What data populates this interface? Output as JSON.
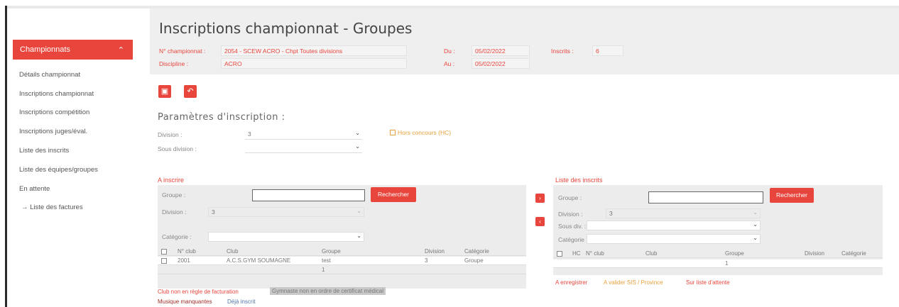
{
  "page": {
    "title": "Inscriptions championnat - Groupes"
  },
  "sidebar": {
    "header": "Championnats",
    "items": [
      "Détails championnat",
      "Inscriptions championnat",
      "Inscriptions compétition",
      "Inscriptions juges/éval.",
      "Liste des inscrits",
      "Liste des équipes/groupes",
      "En attente",
      "→ Liste des factures"
    ]
  },
  "header": {
    "num_label": "N° championnat :",
    "num_value": "2054 - SCEW ACRO - Chpt Toutes divisions",
    "discipline_label": "Discipline :",
    "discipline_value": "ACRO",
    "du_label": "Du :",
    "du_value": "05/02/2022",
    "au_label": "Au :",
    "au_value": "05/02/2022",
    "inscrits_label": "Inscrits :",
    "inscrits_value": "6"
  },
  "toolbar": {
    "save_icon": "save-icon",
    "back_icon": "back-icon"
  },
  "params": {
    "title": "Paramètres d'inscription :",
    "division_label": "Division :",
    "division_value": "3",
    "sous_division_label": "Sous division :",
    "sous_division_value": "",
    "hors_concours_label": "Hors concours (HC)"
  },
  "left_panel": {
    "title": "A inscrire",
    "groupe_label": "Groupe :",
    "search_button": "Rechercher",
    "division_label": "Division :",
    "division_value": "3",
    "categorie_label": "Catégorie :",
    "columns": [
      "N° club",
      "Club",
      "Groupe",
      "Division",
      "Catégorie"
    ],
    "rows": [
      {
        "num": "2001",
        "club": "A.C.S.GYM SOUMAGNE",
        "groupe": "test",
        "division": "3",
        "categorie": "Groupe"
      }
    ],
    "footer": "1",
    "legend": [
      {
        "text": "Club non en règle de facturation",
        "color": "#e8453c"
      },
      {
        "text": "Gymnaste non en ordre de certificat médical",
        "color": "#777"
      },
      {
        "text": "Musique manquantes",
        "color": "#a0302a"
      },
      {
        "text": "Déjà inscrit",
        "color": "#5577aa"
      }
    ]
  },
  "right_panel": {
    "title": "Liste des inscrits",
    "groupe_label": "Groupe :",
    "search_button": "Rechercher",
    "division_label": "Division :",
    "division_value": "3",
    "sous_div_label": "Sous div. :",
    "categorie_label": "Catégorie :",
    "columns": [
      "HC",
      "N° club",
      "Club",
      "Groupe",
      "Division",
      "Catégorie"
    ],
    "footer": "1",
    "legend": [
      {
        "text": "A enregistrer",
        "color": "#e8453c"
      },
      {
        "text": "A valider SIS / Province",
        "color": "#e8a13c"
      },
      {
        "text": "Sur liste d'attente",
        "color": "#e8453c"
      }
    ]
  },
  "transfer": {
    "add_icon": "arrow-right-icon",
    "remove_icon": "arrow-left-icon"
  },
  "colors": {
    "accent": "#e8453c",
    "header_bg": "#efefef",
    "panel_bg": "#ececec"
  }
}
